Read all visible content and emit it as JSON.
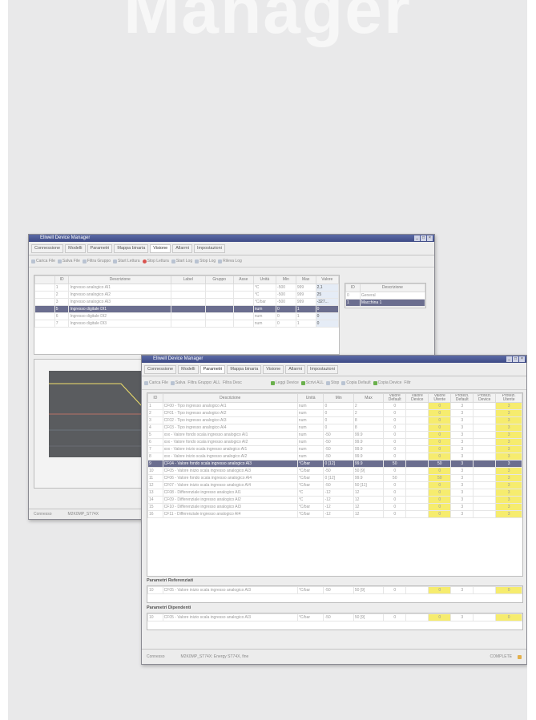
{
  "hero_title": "Manager",
  "back_window": {
    "title": "Eliwell Device Manager",
    "tabs": [
      "Connessione",
      "Modelli",
      "Parametri",
      "Mappa binaria",
      "Visione",
      "Allarmi",
      "Impostazioni"
    ],
    "active_tab": 4,
    "toolbar": [
      "Carica File",
      "Salva File",
      "Filtra Gruppo",
      "Start Lettura",
      "Stop Lettura",
      "Start Log",
      "Stop Log",
      "Rileva Log"
    ],
    "table_headers": [
      "ID",
      "Descrizione",
      "Label",
      "Gruppo",
      "Asse",
      "Unità",
      "Min",
      "Max",
      "Valore"
    ],
    "rows": [
      {
        "id": "1",
        "desc": "Ingresso analogico AI1",
        "unit": "°C",
        "min": "-500",
        "max": "999",
        "value": "2,1"
      },
      {
        "id": "2",
        "desc": "Ingresso analogico AI2",
        "unit": "°C",
        "min": "-500",
        "max": "999",
        "value": "25"
      },
      {
        "id": "3",
        "desc": "Ingresso analogico AI3",
        "unit": "°C/bar",
        "min": "-500",
        "max": "999",
        "value": "-327..."
      },
      {
        "id": "5",
        "desc": "Ingresso digitale DI1",
        "unit": "num",
        "min": "0",
        "max": "1",
        "value": "0"
      },
      {
        "id": "6",
        "desc": "Ingresso digitale DI2",
        "unit": "num",
        "min": "0",
        "max": "1",
        "value": "0"
      },
      {
        "id": "7",
        "desc": "Ingresso digitale DI3",
        "unit": "num",
        "min": "0",
        "max": "1",
        "value": "0"
      }
    ],
    "side_headers": [
      "ID",
      "Descrizione"
    ],
    "side_rows": [
      {
        "id": "0",
        "desc": "General"
      },
      {
        "id": "1",
        "desc": "Macchina 1"
      }
    ],
    "status": "Connesso",
    "status_device": "M2K0MP_ST74X"
  },
  "front_window": {
    "title": "Eliwell Device Manager",
    "tabs": [
      "Connessione",
      "Modelli",
      "Parametri",
      "Mappa binaria",
      "Visione",
      "Allarmi",
      "Impostazioni"
    ],
    "active_tab": 2,
    "toolbar": {
      "load": "Carica File",
      "save": "Salva",
      "group_filter": "Filtra Gruppo: ALL",
      "desc_filter": "Filtra Desc",
      "read_device": "Leggi Device",
      "write": "Scrivi ALL",
      "stop": "Stop",
      "copy_default": "Copia Default",
      "copy_device": "Copia Device",
      "filter": "Filtr"
    },
    "headers": [
      "ID",
      "Descrizione",
      "Unità",
      "Min",
      "Max",
      "Valore Default",
      "Valore Device",
      "Valore Utente",
      "Protezi. Default",
      "Protezi. Device",
      "Protezi. Utente"
    ],
    "rows": [
      {
        "id": "1",
        "desc": "CF00 - Tipo ingresso analogico AI1",
        "unit": "num",
        "min": "0",
        "max": "2",
        "vd": "0",
        "vu": "0",
        "pd": "3",
        "pu": "3"
      },
      {
        "id": "2",
        "desc": "CF01 - Tipo ingresso analogico AI2",
        "unit": "num",
        "min": "0",
        "max": "2",
        "vd": "0",
        "vu": "0",
        "pd": "3",
        "pu": "3"
      },
      {
        "id": "3",
        "desc": "CF02 - Tipo ingresso analogico AI3",
        "unit": "num",
        "min": "0",
        "max": "8",
        "vd": "0",
        "vu": "0",
        "pd": "3",
        "pu": "3"
      },
      {
        "id": "4",
        "desc": "CF03 - Tipo ingresso analogico AI4",
        "unit": "num",
        "min": "0",
        "max": "8",
        "vd": "0",
        "vu": "0",
        "pd": "3",
        "pu": "3"
      },
      {
        "id": "5",
        "desc": "xxx - Valore fondo scala ingresso analogico AI1",
        "unit": "num",
        "min": "-50",
        "max": "99.9",
        "vd": "0",
        "vu": "0",
        "pd": "3",
        "pu": "3"
      },
      {
        "id": "6",
        "desc": "xxx - Valore fondo scala ingresso analogico AI2",
        "unit": "num",
        "min": "-50",
        "max": "99.9",
        "vd": "0",
        "vu": "0",
        "pd": "3",
        "pu": "3"
      },
      {
        "id": "7",
        "desc": "xxx - Valore inizio scala ingresso analogico AI1",
        "unit": "num",
        "min": "-50",
        "max": "99.9",
        "vd": "0",
        "vu": "0",
        "pd": "3",
        "pu": "3"
      },
      {
        "id": "8",
        "desc": "xxx - Valore inizio scala ingresso analogico AI2",
        "unit": "num",
        "min": "-50",
        "max": "99.9",
        "vd": "0",
        "vu": "0",
        "pd": "3",
        "pu": "3"
      },
      {
        "id": "9",
        "desc": "CF04 - Valore fondo scala ingresso analogico AI3",
        "unit": "°C/bar",
        "min": "0 [12]",
        "max": "99.9",
        "vd": "50",
        "vu": "50",
        "pd": "3",
        "pu": "3",
        "sel": true
      },
      {
        "id": "10",
        "desc": "CF05 - Valore inizio scala ingresso analogico AI3",
        "unit": "°C/bar",
        "min": "-50",
        "max": "50 [9]",
        "vd": "0",
        "vu": "0",
        "pd": "3",
        "pu": "3"
      },
      {
        "id": "11",
        "desc": "CF06 - Valore fondo scala ingresso analogico AI4",
        "unit": "°C/bar",
        "min": "0 [12]",
        "max": "99.9",
        "vd": "50",
        "vu": "50",
        "pd": "3",
        "pu": "3"
      },
      {
        "id": "12",
        "desc": "CF07 - Valore inizio scala ingresso analogico AI4",
        "unit": "°C/bar",
        "min": "-50",
        "max": "50 [11]",
        "vd": "0",
        "vu": "0",
        "pd": "3",
        "pu": "3"
      },
      {
        "id": "13",
        "desc": "CF08 - Differenziale ingresso analogico AI1",
        "unit": "°C",
        "min": "-12",
        "max": "12",
        "vd": "0",
        "vu": "0",
        "pd": "3",
        "pu": "3"
      },
      {
        "id": "14",
        "desc": "CF09 - Differenziale ingresso analogico AI2",
        "unit": "°C",
        "min": "-12",
        "max": "12",
        "vd": "0",
        "vu": "0",
        "pd": "3",
        "pu": "3"
      },
      {
        "id": "15",
        "desc": "CF10 - Differenziale ingresso analogico AI3",
        "unit": "°C/bar",
        "min": "-12",
        "max": "12",
        "vd": "0",
        "vu": "0",
        "pd": "3",
        "pu": "3"
      },
      {
        "id": "16",
        "desc": "CF11 - Differenziale ingresso analogico AI4",
        "unit": "°C/bar",
        "min": "-12",
        "max": "12",
        "vd": "0",
        "vu": "0",
        "pd": "3",
        "pu": "3"
      }
    ],
    "ref_label": "Parametri Referenziati",
    "ref_row": {
      "id": "10",
      "desc": "CF05 - Valore inizio scala ingresso analogico AI3",
      "unit": "°C/bar",
      "min": "-50",
      "max": "50 [9]",
      "vd": "0",
      "vu": "0",
      "pd": "3",
      "pu": "0"
    },
    "dep_label": "Parametri Dipendenti",
    "dep_row": {
      "id": "10",
      "desc": "CF05 - Valore inizio scala ingresso analogico AI3",
      "unit": "°C/bar",
      "min": "-50",
      "max": "50 [9]",
      "vd": "0",
      "vu": "0",
      "pd": "3",
      "pu": "0"
    },
    "status": "Connesso",
    "status_device": "M2K0MP_ST74X: Energy ST74X, fine",
    "status_right": "COMPLETE"
  }
}
